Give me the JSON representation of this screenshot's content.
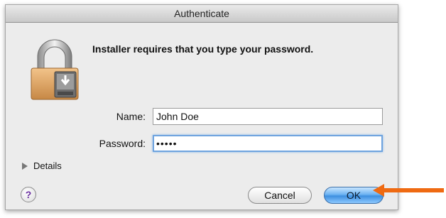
{
  "window": {
    "title": "Authenticate"
  },
  "dialog": {
    "message": "Installer requires that you type your password.",
    "name_label": "Name:",
    "name_value": "John Doe",
    "password_label": "Password:",
    "password_value": "•••••",
    "details_label": "Details",
    "help_label": "?",
    "cancel_label": "Cancel",
    "ok_label": "OK"
  },
  "icons": {
    "lock": "lock-icon",
    "disclosure": "disclosure-triangle-icon",
    "help": "help-icon",
    "callout": "arrow-left-icon"
  },
  "colors": {
    "default_button": "#4a97e6",
    "focus_ring": "#6ea3de",
    "callout_arrow": "#ef6a12",
    "help_glyph": "#6a2fa0"
  }
}
